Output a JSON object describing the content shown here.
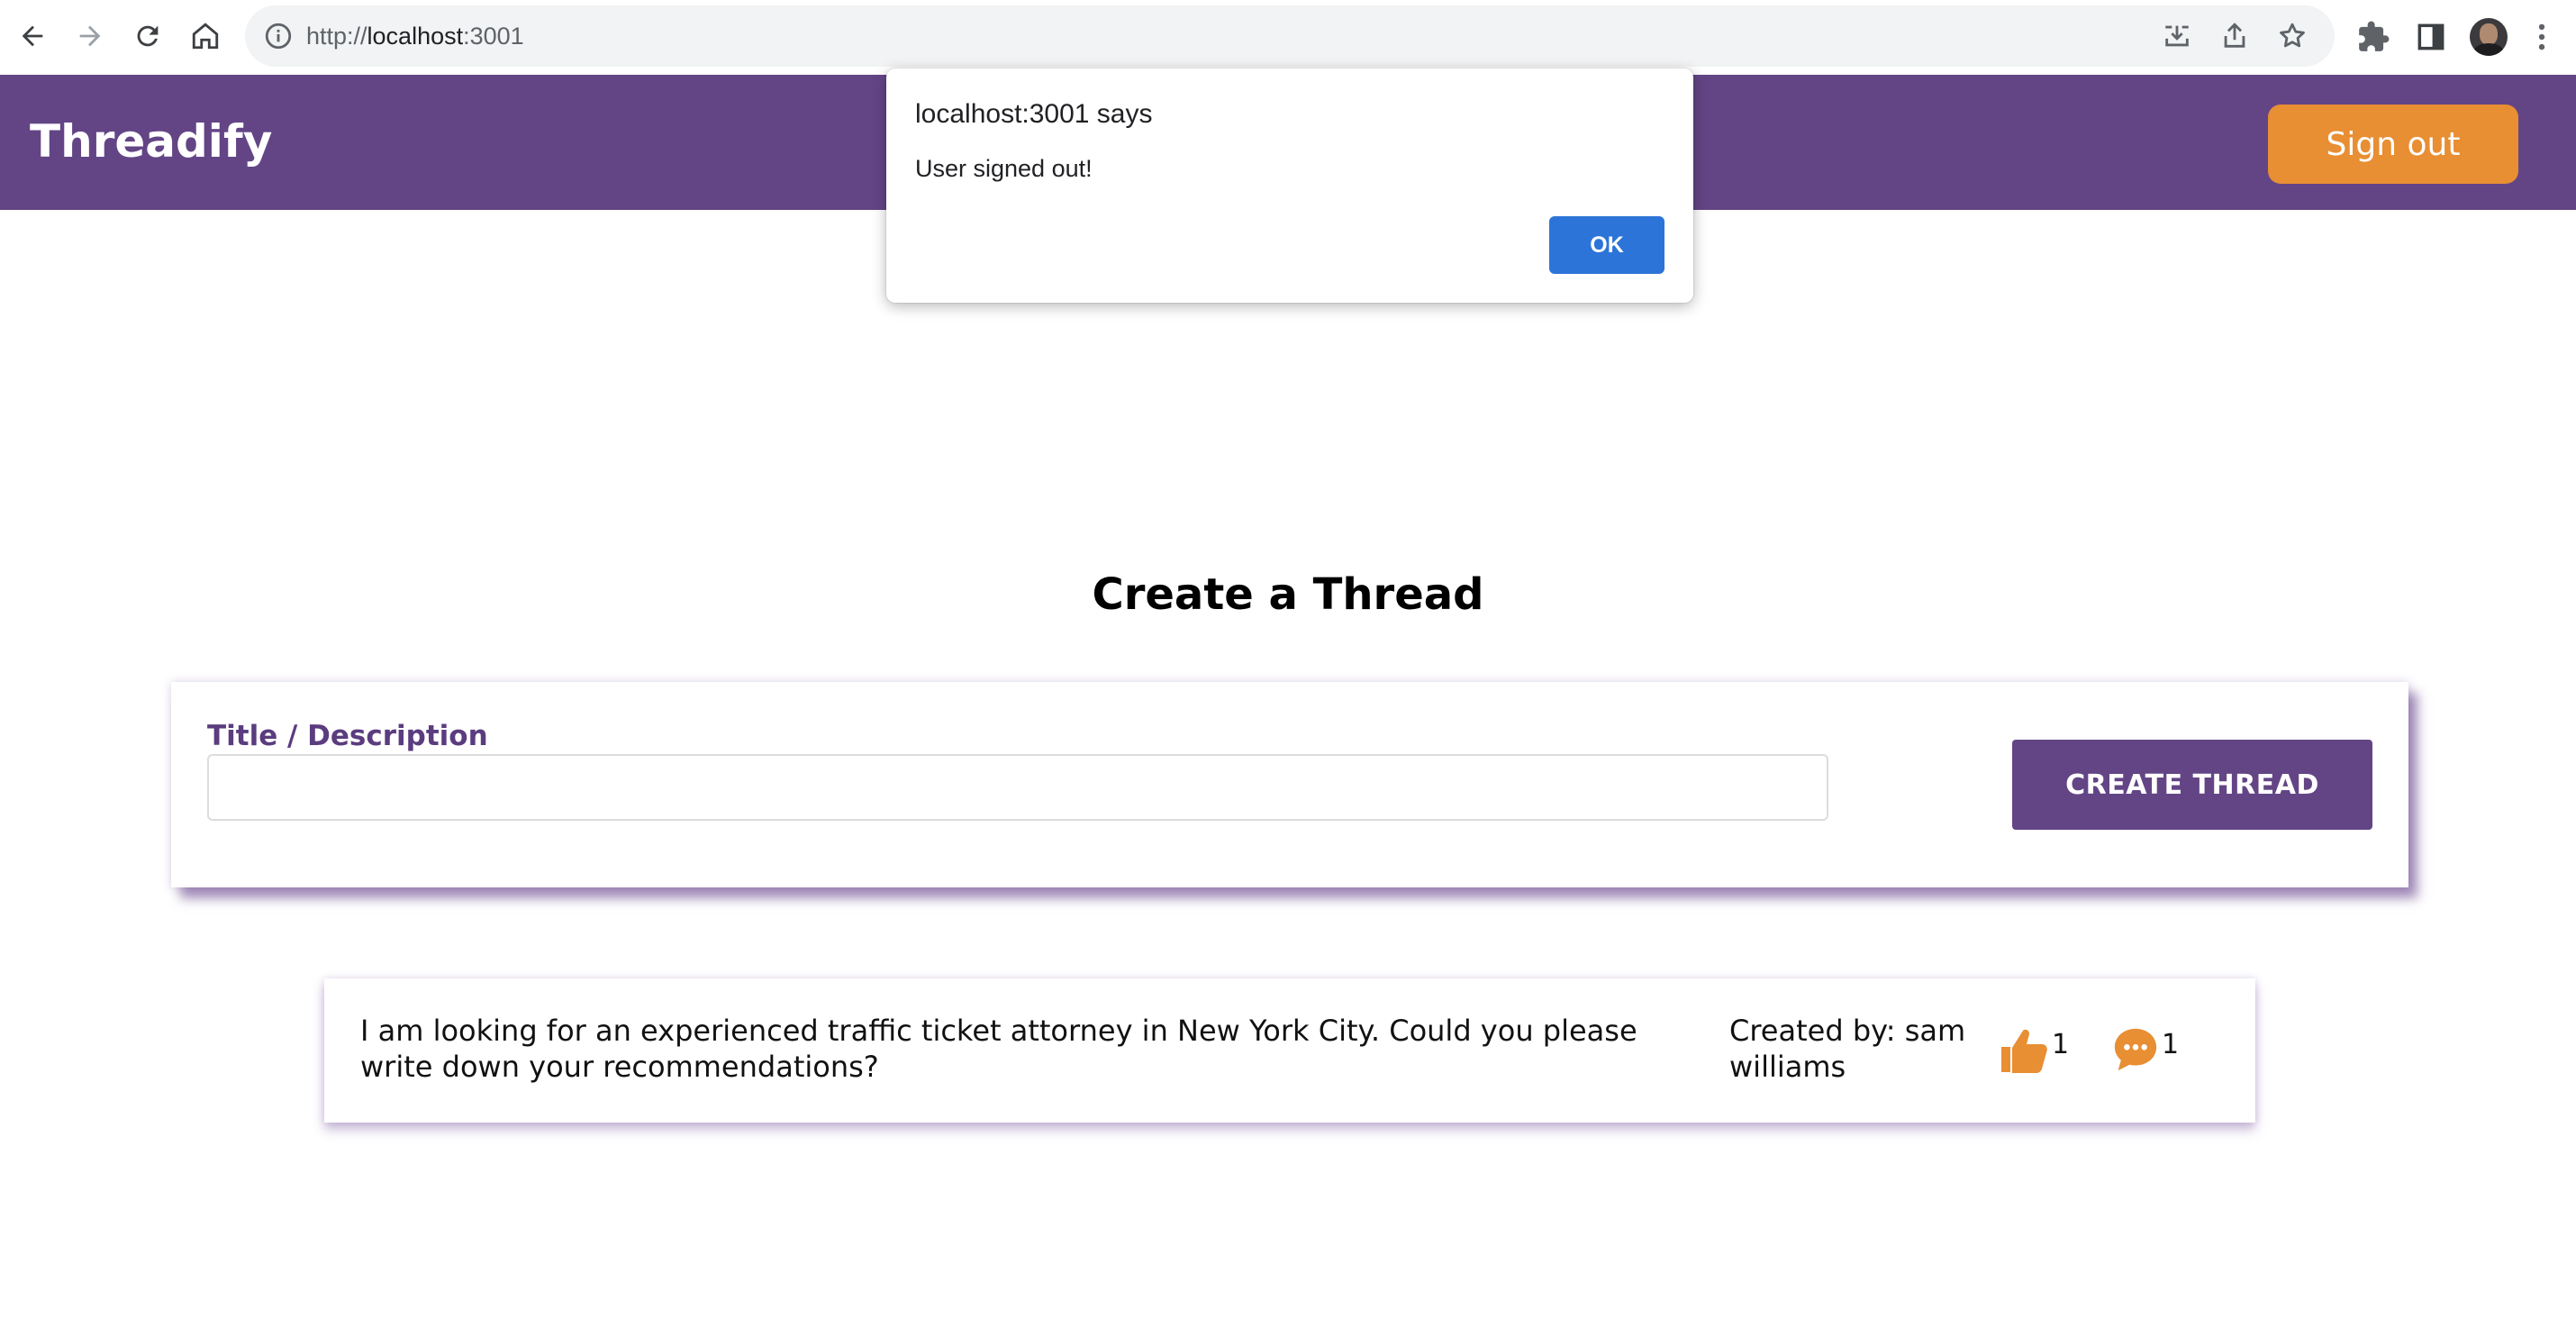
{
  "browser": {
    "url_scheme": "http://",
    "url_host": "localhost",
    "url_port": ":3001",
    "icons": [
      "back-icon",
      "forward-icon",
      "reload-icon",
      "home-icon",
      "info-icon",
      "install-icon",
      "share-icon",
      "bookmark-star-icon",
      "extensions-icon",
      "side-panel-icon",
      "profile-avatar",
      "menu-icon"
    ]
  },
  "header": {
    "brand": "Threadify",
    "signout_label": "Sign out"
  },
  "main": {
    "title": "Create a Thread",
    "form": {
      "label": "Title / Description",
      "input_value": "",
      "button_label": "CREATE THREAD"
    },
    "threads": [
      {
        "text": "I am looking for an experienced traffic ticket attorney in New York City. Could you please write down your recommendations?",
        "author": "Created by: sam williams",
        "likes": "1",
        "comments": "1"
      }
    ]
  },
  "dialog": {
    "title": "localhost:3001 says",
    "message": "User signed out!",
    "ok_label": "OK"
  },
  "colors": {
    "brand_purple": "#634586",
    "accent_orange": "#e88e33",
    "dialog_blue": "#2c74d8"
  }
}
